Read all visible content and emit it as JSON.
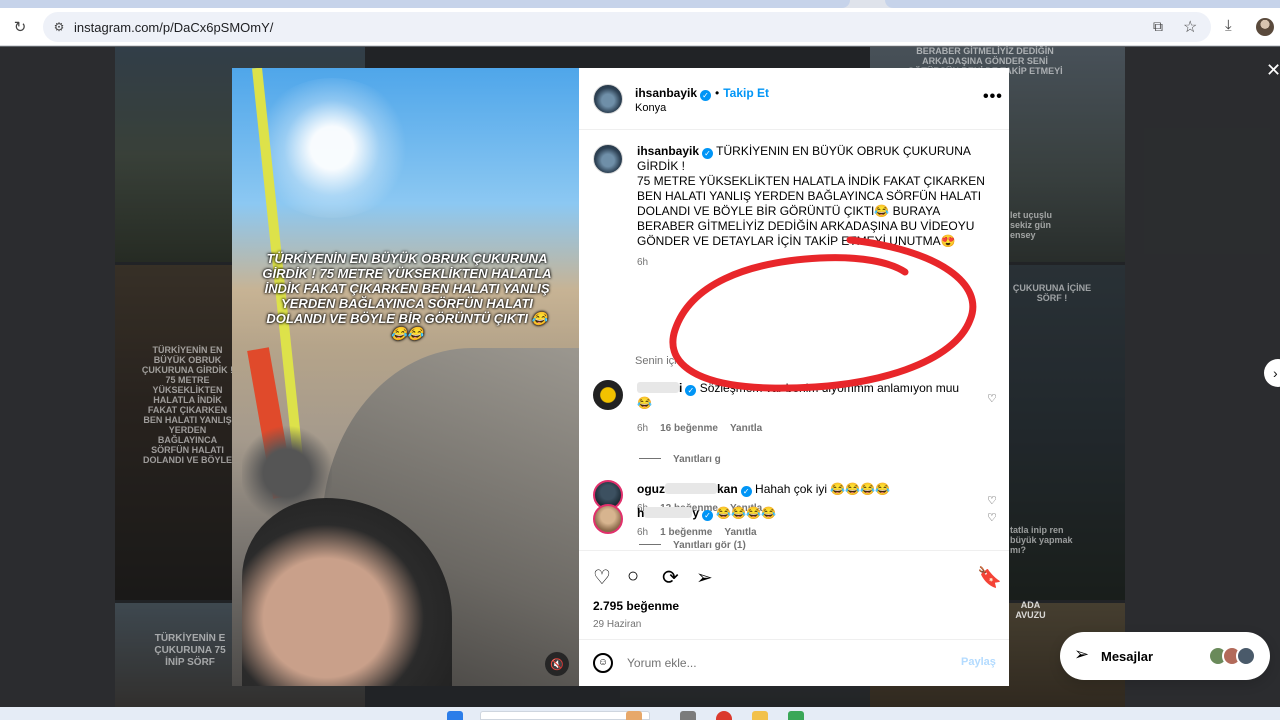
{
  "browser": {
    "url": "instagram.com/p/DaCx6pSMOmY/"
  },
  "post": {
    "username": "ihsanbayik",
    "follow_label": "Takip Et",
    "location": "Konya",
    "more_label": "•••",
    "video_caption": "TÜRKİYENİN EN BÜYÜK OBRUK ÇUKURUNA GİRDİK ! 75 METRE YÜKSEKLİKTEN HALATLA İNDİK FAKAT ÇIKARKEN BEN HALATI YANLIŞ YERDEN BAĞLAYINCA SÖRFÜN HALATI DOLANDI VE BÖYLE BİR GÖRÜNTÜ ÇIKTI 😂😂😂",
    "caption_line1": "TÜRKİYENIN EN BÜYÜK OBRUK ÇUKURUNA",
    "caption_line2": "GİRDİK !",
    "caption_body": "75 METRE YÜKSEKLİKTEN HALATLA İNDİK FAKAT ÇIKARKEN BEN HALATI YANLIŞ YERDEN BAĞLAYINCA SÖRFÜN HALATI DOLANDI VE BÖYLE BİR GÖRÜNTÜ ÇIKTI😂 BURAYA BERABER GİTMELİYİZ DEDİĞİN ARKADAŞINA BU VİDEOYU GÖNDER VE DETAYLAR İÇİN TAKİP ETMEYİ UNUTMA😍",
    "caption_time": "6h",
    "for_you_label": "Senin için",
    "likes": "2.795 beğenme",
    "date": "29 Haziran",
    "add_comment_placeholder": "Yorum ekle...",
    "post_label": "Paylaş"
  },
  "comments": [
    {
      "username_visible": "i",
      "text": "Sözleşmem var benim diyommm anlamıyon muu 😂",
      "time": "6h",
      "likes": "16 beğenme",
      "reply": "Yanıtla",
      "view_replies": "Yanıtları g"
    },
    {
      "username_visible": "oguz",
      "username_suffix": "kan",
      "text": "Hahah çok iyi 😂😂😂😂",
      "time": "6h",
      "likes": "12 beğenme",
      "reply": "Yanıtla",
      "view_replies": "Yanıtları gör (1)"
    },
    {
      "username_visible": "h",
      "username_suffix": "y",
      "text": "😂😂😂😂",
      "time": "6h",
      "likes": "1 beğenme",
      "reply": "Yanıtla"
    }
  ],
  "messages": {
    "label": "Mesajlar"
  },
  "background_texts": {
    "t1": "BERABER GİTMELİYİZ DEDİĞİN ARKADAŞINA GÖNDER SENİ GÖTÜRSÜN BENİ DE TAKİP ETMEYİ UNUTMA",
    "t2": "TÜRKİYENİN EN BÜYÜK OBRUK ÇUKURUNA GİRDİK ! 75 METRE YÜKSEKLİKTEN HALATLA İNDİK FAKAT ÇIKARKEN BEN HALATI YANLIŞ YERDEN BAĞLAYINCA SÖRFÜN HALATI DOLANDI VE BÖYLE",
    "t3": "ÇUKURUNA İÇİNE SÖRF !",
    "t4": "TÜRKİYENİN E ÇUKURUNA 75 İNİP SÖRF",
    "t5": "tatla inip ren büyük yapmak mı?",
    "t6": "ADA AVUZU",
    "t7": "let uçuşlu sekiz gün ensey"
  },
  "colors": {
    "accent": "#0095f6",
    "annotation": "#e8262a"
  }
}
